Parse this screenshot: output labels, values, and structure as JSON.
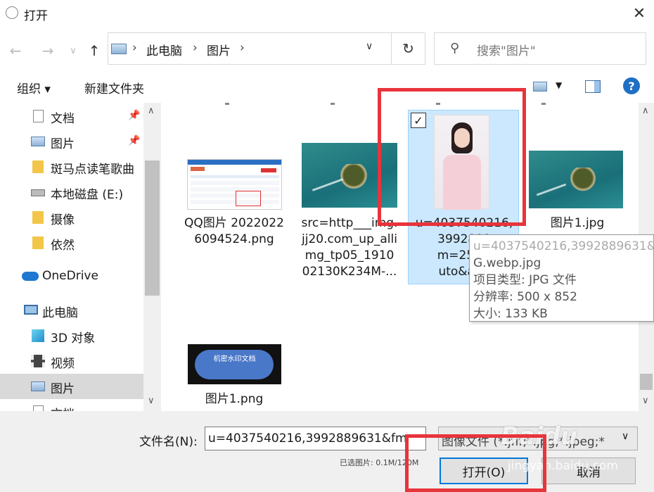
{
  "window": {
    "title": "打开"
  },
  "address": {
    "crumbs": [
      "此电脑",
      "图片"
    ],
    "separator": "›"
  },
  "search": {
    "placeholder": "搜索\"图片\""
  },
  "toolbar": {
    "organize": "组织 ▾",
    "new_folder": "新建文件夹"
  },
  "sidebar": {
    "items": [
      {
        "label": "文档",
        "icon": "document-icon",
        "pinned": true
      },
      {
        "label": "图片",
        "icon": "pictures-icon",
        "pinned": true
      },
      {
        "label": "斑马点读笔歌曲",
        "icon": "folder-icon"
      },
      {
        "label": "本地磁盘 (E:)",
        "icon": "drive-icon"
      },
      {
        "label": "摄像",
        "icon": "folder-icon"
      },
      {
        "label": "依然",
        "icon": "folder-icon"
      },
      {
        "label": "OneDrive",
        "icon": "cloud-icon"
      },
      {
        "label": "此电脑",
        "icon": "computer-icon"
      },
      {
        "label": "3D 对象",
        "icon": "cube-icon"
      },
      {
        "label": "视频",
        "icon": "video-icon"
      },
      {
        "label": "图片",
        "icon": "pictures-icon",
        "selected": true
      },
      {
        "label": "文档",
        "icon": "document-icon"
      }
    ]
  },
  "files": [
    {
      "name": "QQ图片\n20220226094524.png",
      "type": "screenshot"
    },
    {
      "name": "src=http___img.\njj20.com_up_alli\nmg_tp05_1910\n02130K234M-...",
      "type": "island"
    },
    {
      "name": "u=4037540216,\n3992889\nm=253&\nuto&app",
      "type": "portrait",
      "selected": true
    },
    {
      "name": "图片1.jpg",
      "type": "island"
    },
    {
      "name": "图片1.png",
      "type": "cloud",
      "cloud_text": "机密水印文档"
    }
  ],
  "tooltip": {
    "line1": "u=4037540216,3992889631&",
    "line2": "G.webp.jpg",
    "line3": "项目类型: JPG 文件",
    "line4": "分辨率: 500 x 852",
    "line5": "大小: 133 KB"
  },
  "bottom": {
    "filename_label": "文件名(N):",
    "filename_value": "u=4037540216,3992889631&fm",
    "filetype": "图像文件 (*.jfif;*.jpg;*.jpeg;*",
    "selection_info": "已选图片: 0.1M/120M",
    "open_label": "打开(O)",
    "cancel_label": "取消"
  },
  "watermark": {
    "logo": "Baidu",
    "site": "jingyan.baidu.com"
  },
  "colors": {
    "accent": "#0078d7",
    "selection": "#cce8ff",
    "annotation": "#e8343b"
  }
}
